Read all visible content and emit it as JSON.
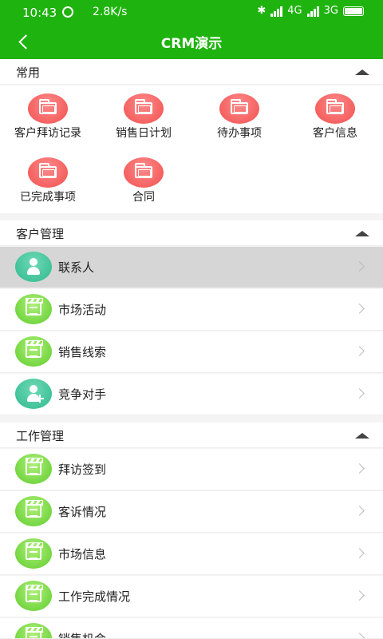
{
  "status_bar": {
    "time": "10:43",
    "speed": "2.8K/s",
    "network_1": "4G",
    "network_2": "3G"
  },
  "app_bar": {
    "title": "CRM演示"
  },
  "sections": {
    "common": {
      "label": "常用",
      "tiles": [
        {
          "label": "客户拜访记录",
          "icon": "folder-icon"
        },
        {
          "label": "销售日计划",
          "icon": "folder-icon"
        },
        {
          "label": "待办事项",
          "icon": "folder-icon"
        },
        {
          "label": "客户信息",
          "icon": "folder-icon"
        },
        {
          "label": "已完成事项",
          "icon": "folder-icon"
        },
        {
          "label": "合同",
          "icon": "folder-icon"
        }
      ]
    },
    "customer": {
      "label": "客户管理",
      "items": [
        {
          "label": "联系人",
          "icon": "person-icon"
        },
        {
          "label": "市场活动",
          "icon": "clapboard-icon"
        },
        {
          "label": "销售线索",
          "icon": "clapboard-icon"
        },
        {
          "label": "竞争对手",
          "icon": "add-person-icon"
        }
      ]
    },
    "work": {
      "label": "工作管理",
      "items": [
        {
          "label": "拜访签到",
          "icon": "clapboard-icon"
        },
        {
          "label": "客诉情况",
          "icon": "clapboard-icon"
        },
        {
          "label": "市场信息",
          "icon": "clapboard-icon"
        },
        {
          "label": "工作完成情况",
          "icon": "clapboard-icon"
        },
        {
          "label": "销售机会",
          "icon": "clapboard-icon"
        }
      ]
    }
  },
  "colors": {
    "primary": "#1fb30f",
    "tile_icon": "#f05050",
    "row_icon_green": "#5fcc2c",
    "row_icon_teal": "#2fb98e",
    "selected_row": "#d6d6d6"
  }
}
